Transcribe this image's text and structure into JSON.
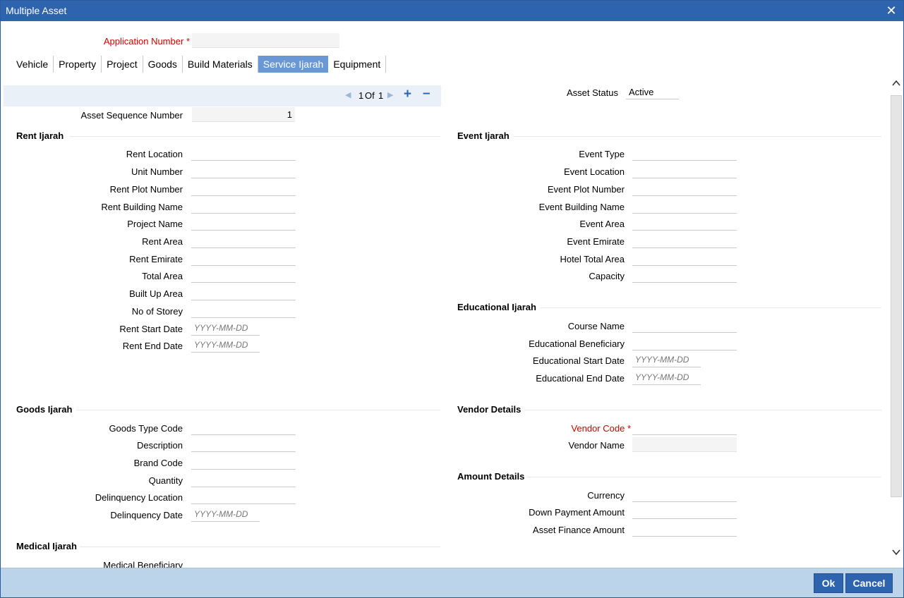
{
  "window": {
    "title": "Multiple Asset"
  },
  "header": {
    "application_number_label": "Application Number",
    "required_mark": "*",
    "application_number_value": ""
  },
  "tabs": [
    {
      "label": "Vehicle",
      "active": false
    },
    {
      "label": "Property",
      "active": false
    },
    {
      "label": "Project",
      "active": false
    },
    {
      "label": "Goods",
      "active": false
    },
    {
      "label": "Build Materials",
      "active": false
    },
    {
      "label": "Service Ijarah",
      "active": true
    },
    {
      "label": "Equipment",
      "active": false
    }
  ],
  "navigator": {
    "current": "1",
    "of_label": "Of",
    "total": "1"
  },
  "asset": {
    "sequence_label": "Asset Sequence Number",
    "sequence_value": "1",
    "status_label": "Asset Status",
    "status_value": "Active"
  },
  "rent_ijarah": {
    "title": "Rent Ijarah",
    "fields": {
      "rent_location": "Rent Location",
      "unit_number": "Unit Number",
      "rent_plot_number": "Rent Plot Number",
      "rent_building_name": "Rent Building Name",
      "project_name": "Project Name",
      "rent_area": "Rent Area",
      "rent_emirate": "Rent Emirate",
      "total_area": "Total Area",
      "built_up_area": "Built Up Area",
      "no_of_storey": "No of Storey",
      "rent_start_date": "Rent Start Date",
      "rent_end_date": "Rent End Date"
    }
  },
  "event_ijarah": {
    "title": "Event Ijarah",
    "fields": {
      "event_type": "Event Type",
      "event_location": "Event Location",
      "event_plot_number": "Event Plot Number",
      "event_building_name": "Event Building Name",
      "event_area": "Event Area",
      "event_emirate": "Event Emirate",
      "hotel_total_area": "Hotel Total Area",
      "capacity": "Capacity"
    }
  },
  "educational_ijarah": {
    "title": "Educational Ijarah",
    "fields": {
      "course_name": "Course Name",
      "educational_beneficiary": "Educational Beneficiary",
      "educational_start_date": "Educational Start Date",
      "educational_end_date": "Educational End Date"
    }
  },
  "goods_ijarah": {
    "title": "Goods Ijarah",
    "fields": {
      "goods_type_code": "Goods Type Code",
      "description": "Description",
      "brand_code": "Brand Code",
      "quantity": "Quantity",
      "delinquency_location": "Delinquency Location",
      "delinquency_date": "Delinquency Date"
    }
  },
  "medical_ijarah": {
    "title": "Medical Ijarah",
    "fields": {
      "medical_beneficiary": "Medical Beneficiary"
    }
  },
  "vendor_details": {
    "title": "Vendor Details",
    "fields": {
      "vendor_code": "Vendor Code",
      "vendor_name": "Vendor Name"
    }
  },
  "amount_details": {
    "title": "Amount Details",
    "fields": {
      "currency": "Currency",
      "down_payment_amount": "Down Payment Amount",
      "asset_finance_amount": "Asset Finance Amount"
    }
  },
  "date_placeholder": "YYYY-MM-DD",
  "footer": {
    "ok_label": "Ok",
    "cancel_label": "Cancel"
  },
  "colors": {
    "title_bar": "#2e63ad",
    "active_tab": "#6a98d4",
    "required": "#d10000",
    "footer": "#bcd4ea"
  }
}
